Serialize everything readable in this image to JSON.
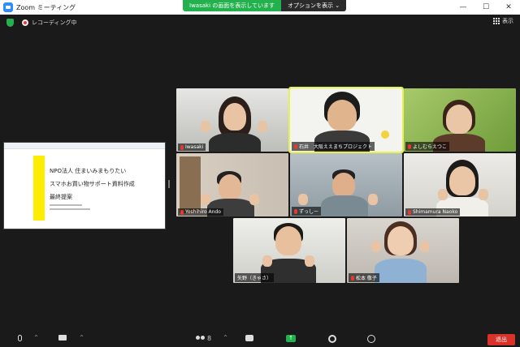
{
  "window": {
    "title": "Zoom ミーティング",
    "minimize": "—",
    "maximize": "☐",
    "close": "✕"
  },
  "share_banner": {
    "text": "Iwasaki の画面を表示しています",
    "options_label": "オプションを表示 ⌄"
  },
  "topbar": {
    "recording_label": "レコーディング中",
    "view_label": "表示"
  },
  "shared_screen": {
    "line1": "NPO法人 住まいみまもりたい",
    "line2": "スマホお買い物サポート資料作成",
    "line3": "最終提案"
  },
  "participants": [
    {
      "name": "Iwasaki"
    },
    {
      "name": "石井　大阪ええまちプロジェクト"
    },
    {
      "name": "よしむらえつこ"
    },
    {
      "name": "Yoshihiro Ando"
    },
    {
      "name": "ずっしー"
    },
    {
      "name": "Shimamura Naoko"
    },
    {
      "name": "矢野（きゃさ）"
    },
    {
      "name": "松本 敬子"
    }
  ],
  "toolbar": {
    "participants_count": "8",
    "share_arrow": "↑",
    "caret": "^",
    "leave_label": "退出"
  },
  "colors": {
    "accent_green": "#23b14d",
    "leave_red": "#d9322b",
    "active_speaker": "#e6f34f"
  }
}
